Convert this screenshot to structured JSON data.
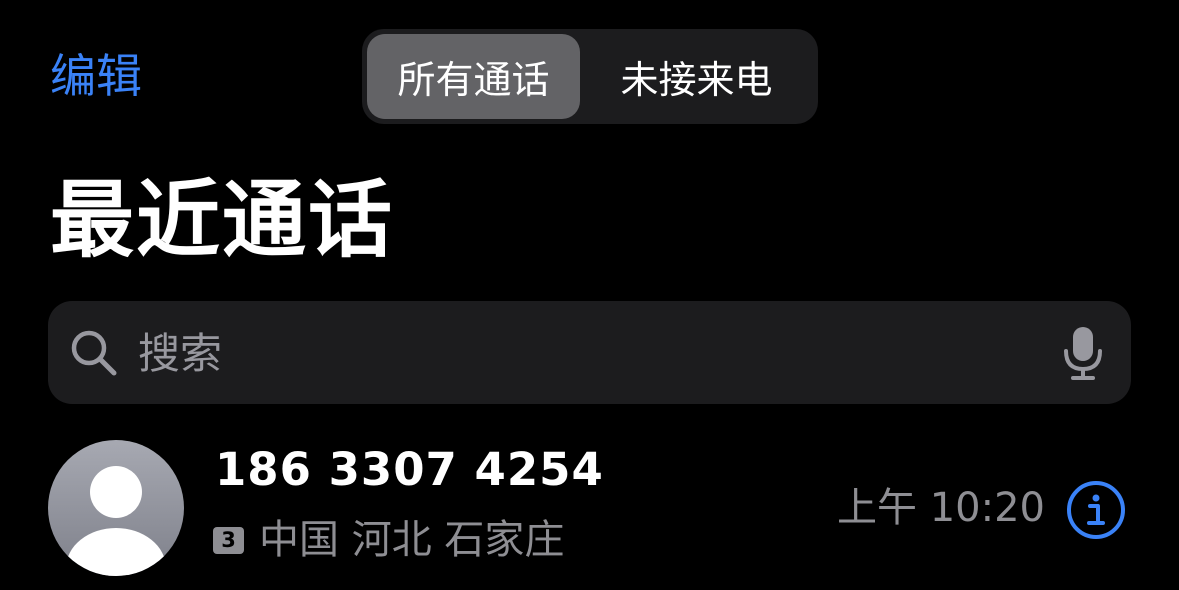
{
  "nav": {
    "edit_label": "编辑"
  },
  "segmented": {
    "options": [
      "所有通话",
      "未接来电"
    ],
    "selected": "所有通话"
  },
  "title": "最近通话",
  "search": {
    "placeholder": "搜索",
    "value": ""
  },
  "calls": [
    {
      "number": "186 3307 4254",
      "sim": "3",
      "location": "中国 河北 石家庄",
      "time": "上午 10:20"
    }
  ],
  "icons": {
    "search": "magnifying-glass",
    "mic": "microphone",
    "avatar": "person-silhouette",
    "info": "info-circle"
  },
  "colors": {
    "accent": "#3a82f7",
    "secondary_text": "#8e8e93",
    "background": "#000000",
    "fill": "#1c1c1e"
  }
}
